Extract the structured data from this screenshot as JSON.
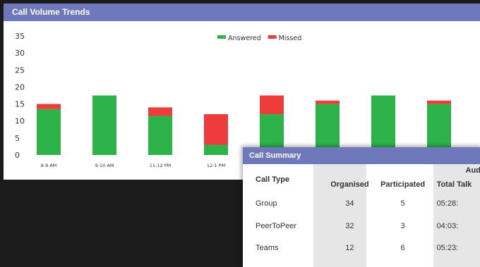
{
  "chart_panel": {
    "title": "Call Volume Trends"
  },
  "chart_data": {
    "type": "bar",
    "stacked": true,
    "categories": [
      "8-9 AM",
      "9-10 AM",
      "11-12 PM",
      "12-1 PM",
      "",
      "",
      "",
      ""
    ],
    "series": [
      {
        "name": "Answered",
        "color": "#2db34a",
        "values": [
          13.5,
          17.5,
          11.5,
          3,
          12,
          15,
          17.5,
          15
        ]
      },
      {
        "name": "Missed",
        "color": "#ee3b3b",
        "values": [
          1.5,
          0,
          2.5,
          9,
          5.5,
          1,
          0,
          1
        ]
      }
    ],
    "yticks": [
      0,
      5,
      10,
      15,
      20,
      25,
      30,
      35
    ],
    "ylim": [
      0,
      35
    ],
    "legend_position": "top-center",
    "grid": false
  },
  "summary_panel": {
    "title": "Call Summary",
    "call_type_header": "Call Type",
    "audio_header": "Audi",
    "headers": {
      "organised": "Organised",
      "participated": "Participated",
      "total_talk": "Total Talk"
    },
    "rows": [
      {
        "type": "Group",
        "organised": "34",
        "participated": "5",
        "total_talk": "05:28:"
      },
      {
        "type": "PeerToPeer",
        "organised": "32",
        "participated": "3",
        "total_talk": "04:03:"
      },
      {
        "type": "Teams",
        "organised": "12",
        "participated": "6",
        "total_talk": "05:23:"
      }
    ]
  }
}
